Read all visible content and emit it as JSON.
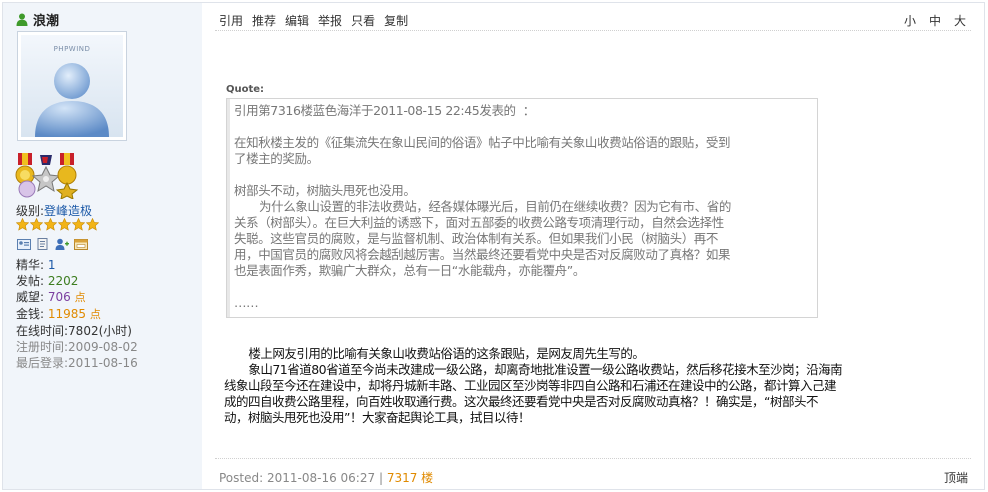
{
  "user": {
    "name": "浪潮",
    "avatar_brand": "PHPWIND",
    "level_label": "级别:",
    "level_value": "登峰造极",
    "stats": [
      {
        "label": "精华:",
        "value": "1"
      },
      {
        "label": "发帖:",
        "value": "2202"
      },
      {
        "label": "威望:",
        "value": "706",
        "unit": "点"
      },
      {
        "label": "金钱:",
        "value": "11985",
        "unit": "点"
      },
      {
        "label": "在线时间:",
        "value": "7802(小时)"
      },
      {
        "label": "注册时间:",
        "value": "2009-08-02"
      },
      {
        "label": "最后登录:",
        "value": "2011-08-16"
      }
    ]
  },
  "toolbar": {
    "quote": "引用",
    "recommend": "推荐",
    "edit": "编辑",
    "report": "举报",
    "only_view": "只看",
    "copy": "复制"
  },
  "font_size": {
    "small": "小",
    "medium": "中",
    "large": "大"
  },
  "quote": {
    "label": "Quote:",
    "lines": [
      "引用第7316楼蓝色海洋于2011-08-15 22:45发表的  ：",
      "",
      "在知秋楼主发的《征集流失在象山民间的俗语》帖子中比喻有关象山收费站俗语的跟贴，受到",
      "了楼主的奖励。",
      "",
      "树部头不动，树脑头甩死也没用。",
      "       为什么象山设置的非法收费站，经各媒体曝光后，目前仍在继续收费？因为它有市、省的",
      "关系（树部头）。在巨大利益的诱惑下，面对五部委的收费公路专项清理行动，自然会选择性",
      "失聪。这些官员的腐败，是与监督机制、政治体制有关系。但如果我们小民（树脑头）再不",
      "用，中国官员的腐败风将会越刮越厉害。当然最终还要看党中央是否对反腐败动了真格？如果",
      "也是表面作秀，欺骗广大群众，总有一日“水能载舟，亦能覆舟”。",
      "",
      "……"
    ]
  },
  "body": {
    "lines": [
      "       楼上网友引用的比喻有关象山收费站俗语的这条跟贴，是网友周先生写的。",
      "       象山71省道80省道至今尚未改建成一级公路，却离奇地批准设置一级公路收费站，然后移花接木至沙岗；沿海南",
      "线象山段至今还在建设中，却将丹城新丰路、工业园区至沙岗等非四自公路和石浦还在建设中的公路，都计算入己建",
      "成的四自收费公路里程，向百姓收取通行费。这次最终还要看党中央是否对反腐败动真格？！确实是，“树部头不",
      "动，树脑头甩死也没用”！大家奋起舆论工具，拭目以待！"
    ]
  },
  "footer": {
    "posted_label": "Posted:",
    "posted_time": "2011-08-16 06:27",
    "separator": "|",
    "floor": "7317 楼",
    "top_link": "顶端"
  }
}
